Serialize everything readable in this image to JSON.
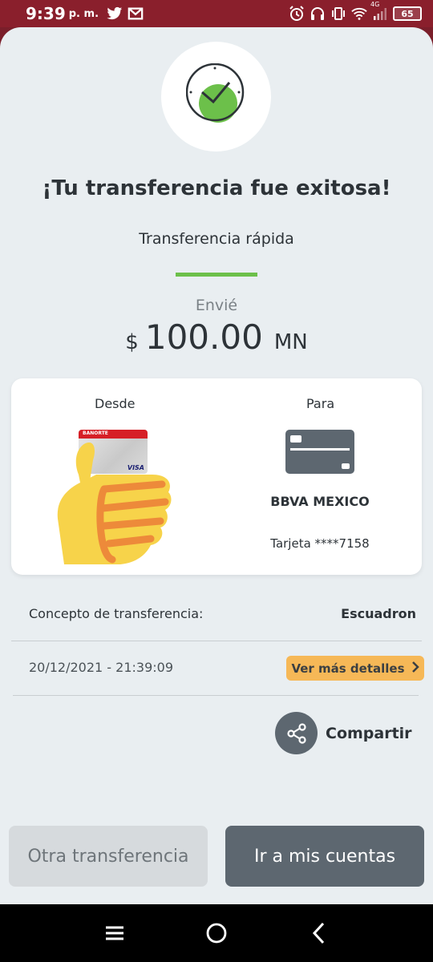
{
  "status_bar": {
    "time": "9:39",
    "ampm": "p. m.",
    "battery": "65",
    "network": "4G"
  },
  "success": {
    "title": "¡Tu transferencia fue exitosa!",
    "subtitle": "Transferencia rápida",
    "sent_label": "Envié",
    "currency_symbol": "$",
    "amount": "100.00",
    "currency_unit": "MN"
  },
  "card": {
    "from_label": "Desde",
    "to_label": "Para",
    "source_card_brand": "BANORTE",
    "source_card_network": "VISA",
    "dest_bank": "BBVA MEXICO",
    "dest_account": "Tarjeta ****7158"
  },
  "details": {
    "concept_label": "Concepto de transferencia:",
    "concept_value": "Escuadron",
    "datetime": "20/12/2021 - 21:39:09",
    "more_details_label": "Ver más detalles",
    "share_label": "Compartir"
  },
  "actions": {
    "other_transfer": "Otra transferencia",
    "my_accounts": "Ir a mis cuentas"
  },
  "colors": {
    "accent_green": "#6cc04a",
    "brand_red": "#8a1f2c",
    "details_button": "#f6b857",
    "primary_button": "#5d6770"
  },
  "icons": {
    "success": "clock-check-icon",
    "share": "share-icon",
    "nav_menu": "menu-icon",
    "nav_home": "home-icon",
    "nav_back": "back-icon"
  }
}
